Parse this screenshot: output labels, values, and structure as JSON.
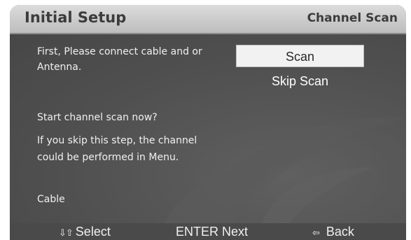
{
  "header": {
    "title": "Initial Setup",
    "section": "Channel Scan"
  },
  "message": {
    "line1": "First, Please connect cable and or",
    "line2": "Antenna.",
    "question": "Start  channel scan now?",
    "skip_info1": "If you skip this step, the channel",
    "skip_info2": "could be performed in Menu.",
    "source": "Cable"
  },
  "buttons": {
    "scan": "Scan",
    "skip_scan": "Skip Scan"
  },
  "footer": {
    "select_icon": "up-down-arrows-icon",
    "select_label": "Select",
    "next_label": "ENTER Next",
    "back_icon": "left-arrow-icon",
    "back_label": "Back"
  }
}
